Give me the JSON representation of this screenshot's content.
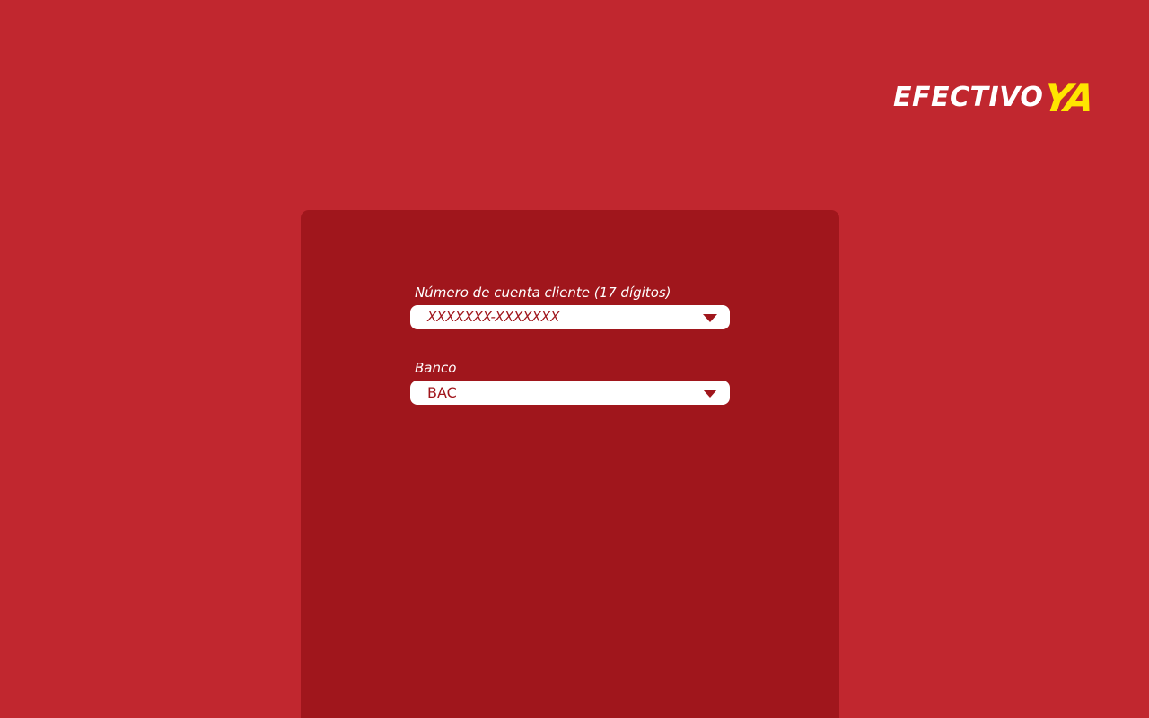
{
  "brand": {
    "logo_main": "EFECTIVO",
    "logo_accent": "YA",
    "accent_color": "#FFE500"
  },
  "form": {
    "account": {
      "label": "Número de cuenta cliente (17 dígitos)",
      "value": "XXXXXXX-XXXXXXX",
      "icon": "chevron-down-icon"
    },
    "bank": {
      "label": "Banco",
      "value": "BAC",
      "icon": "chevron-down-icon"
    }
  },
  "colors": {
    "background": "#C1272F",
    "panel": "#A0161C",
    "field_bg": "#FFFFFF",
    "field_text": "#A0161C"
  }
}
